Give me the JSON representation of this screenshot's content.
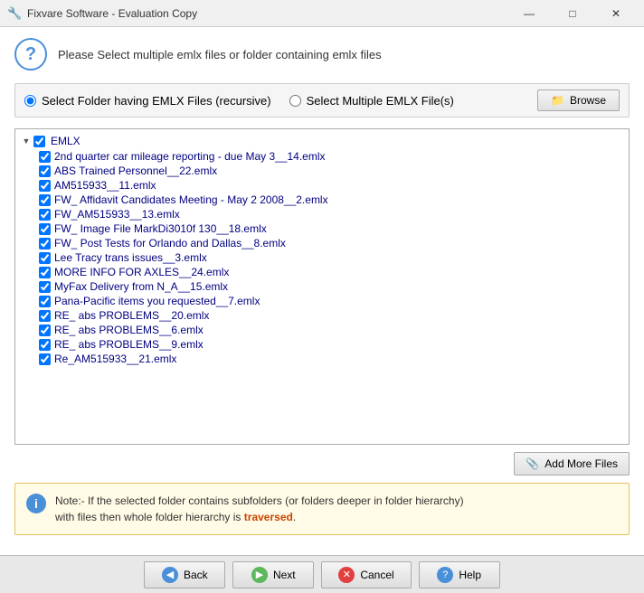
{
  "titlebar": {
    "icon": "🔧",
    "title": "Fixvare Software - Evaluation Copy",
    "minimize": "—",
    "maximize": "□",
    "close": "✕"
  },
  "header": {
    "text": "Please Select multiple emlx files or folder containing emlx files"
  },
  "options": {
    "option1_label": "Select Folder having EMLX Files (recursive)",
    "option2_label": "Select Multiple EMLX File(s)",
    "browse_label": "Browse",
    "browse_icon": "📁"
  },
  "tree": {
    "root_label": "EMLX",
    "files": [
      "2nd quarter car mileage reporting - due May 3__14.emlx",
      "ABS Trained Personnel__22.emlx",
      "AM515933__11.emlx",
      "FW_ Affidavit Candidates Meeting - May 2 2008__2.emlx",
      "FW_AM515933__13.emlx",
      "FW_ Image File MarkDi3010f 130__18.emlx",
      "FW_ Post Tests for Orlando and Dallas__8.emlx",
      "Lee Tracy trans issues__3.emlx",
      "MORE INFO FOR AXLES__24.emlx",
      "MyFax Delivery from N_A__15.emlx",
      "Pana-Pacific items you requested__7.emlx",
      "RE_ abs PROBLEMS__20.emlx",
      "RE_ abs PROBLEMS__6.emlx",
      "RE_ abs PROBLEMS__9.emlx",
      "Re_AM515933__21.emlx"
    ]
  },
  "add_files_btn": {
    "icon": "📎",
    "label": "Add More Files"
  },
  "note": {
    "text_part1": "Note:- If the selected folder contains subfolders (or folders deeper in folder hierarchy)",
    "text_part2": "with files then whole folder hierarchy is",
    "highlight": "traversed",
    "text_part3": "."
  },
  "bottom": {
    "back_label": "Back",
    "next_label": "Next",
    "cancel_label": "Cancel",
    "help_label": "Help"
  }
}
